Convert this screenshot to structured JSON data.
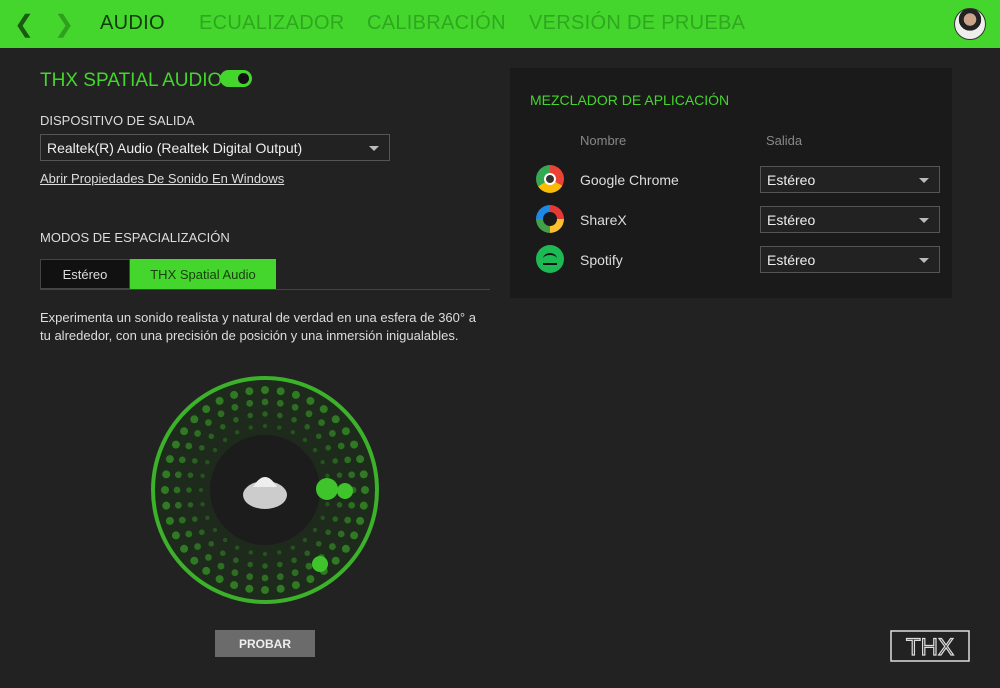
{
  "header": {
    "tabs": [
      "AUDIO",
      "ECUALIZADOR",
      "CALIBRACIÓN",
      "VERSIÓN DE PRUEBA"
    ],
    "active_tab": "AUDIO"
  },
  "main": {
    "title": "THX SPATIAL AUDIO",
    "toggle_on": true,
    "output_label": "DISPOSITIVO DE SALIDA",
    "output_value": "Realtek(R) Audio (Realtek Digital Output)",
    "link": "Abrir Propiedades De Sonido En Windows",
    "modes_label": "MODOS DE ESPACIALIZACIÓN",
    "modes": [
      "Estéreo",
      "THX Spatial Audio"
    ],
    "active_mode": "THX Spatial Audio",
    "description": "Experimenta un sonido realista y natural de verdad en una esfera de 360° a tu alrededor, con una precisión de posición y una inmersión inigualables.",
    "test_button": "PROBAR"
  },
  "mixer": {
    "title": "MEZCLADOR DE APLICACIÓN",
    "col_name": "Nombre",
    "col_output": "Salida",
    "apps": [
      {
        "name": "Google Chrome",
        "output": "Estéreo",
        "icon": "chrome-icon"
      },
      {
        "name": "ShareX",
        "output": "Estéreo",
        "icon": "sharex-icon"
      },
      {
        "name": "Spotify",
        "output": "Estéreo",
        "icon": "spotify-icon"
      }
    ]
  },
  "logo": "THX",
  "colors": {
    "accent": "#44d62c",
    "background": "#222222"
  }
}
